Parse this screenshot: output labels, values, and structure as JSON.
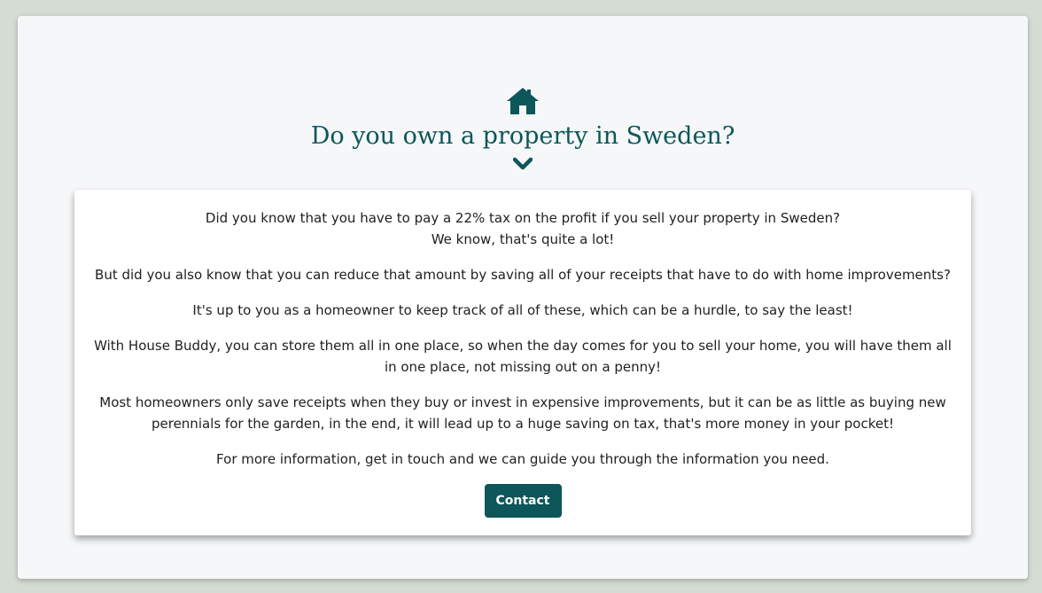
{
  "hero": {
    "icon": "home-icon",
    "title": "Do you own a property in Sweden?",
    "scroll_icon": "chevron-down-icon"
  },
  "info": {
    "p1_line1": "Did you know that you have to pay a 22% tax on the profit if you sell your property in Sweden?",
    "p1_line2": "We know, that's quite a lot!",
    "p2": "But did you also know that you can reduce that amount by saving all of your receipts that have to do with home improvements?",
    "p3": "It's up to you as a homeowner to keep track of all of these, which can be a hurdle, to say the least!",
    "p4": "With House Buddy, you can store them all in one place, so when the day comes for you to sell your home, you will have them all in one place, not missing out on a penny!",
    "p5": "Most homeowners only save receipts when they buy or invest in expensive improvements, but it can be as little as buying new perennials for the garden, in the end, it will lead up to a huge saving on tax, that's more money in your pocket!",
    "p6": "For more information, get in touch and we can guide you through the information you need.",
    "contact_label": "Contact"
  },
  "colors": {
    "accent": "#0d5659",
    "page_background": "#d5dcd4",
    "card_background": "#f6f7f9",
    "panel_background": "#ffffff"
  }
}
